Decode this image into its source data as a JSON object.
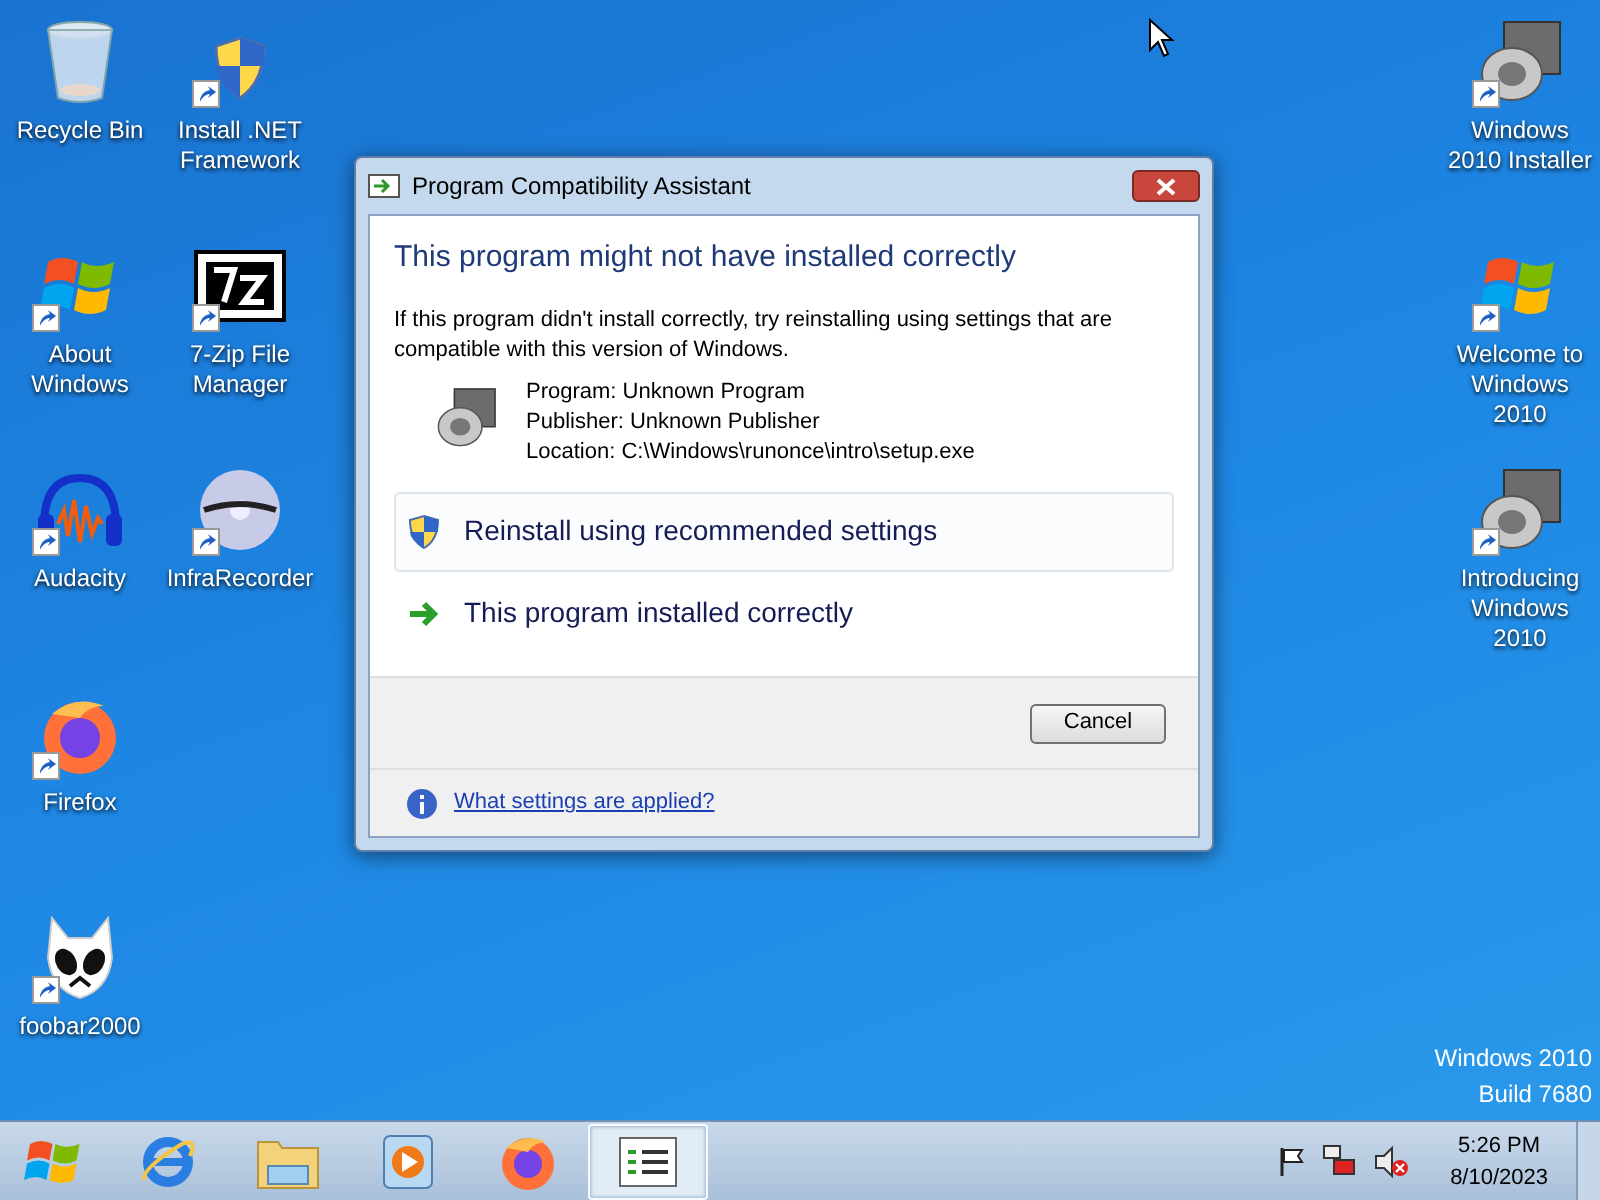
{
  "desktop": {
    "columns": [
      {
        "icons": [
          {
            "label": "Recycle Bin",
            "kind": "bin",
            "shortcut": false
          },
          {
            "label": "About Windows",
            "kind": "winlogo",
            "shortcut": true
          },
          {
            "label": "Audacity",
            "kind": "headphones",
            "shortcut": true
          },
          {
            "label": "Firefox",
            "kind": "firefox",
            "shortcut": true
          },
          {
            "label": "foobar2000",
            "kind": "foobar",
            "shortcut": true
          }
        ]
      },
      {
        "icons": [
          {
            "label": "Install .NET Framework",
            "kind": "shield",
            "shortcut": true
          },
          {
            "label": "7-Zip File Manager",
            "kind": "zip",
            "shortcut": true
          },
          {
            "label": "InfraRecorder",
            "kind": "disc",
            "shortcut": true
          }
        ]
      }
    ],
    "right_column": {
      "icons": [
        {
          "label": "Windows 2010 Installer",
          "kind": "speaker",
          "shortcut": true
        },
        {
          "label": "Welcome to Windows 2010",
          "kind": "winlogo",
          "shortcut": true
        },
        {
          "label": "Introducing Windows 2010",
          "kind": "speaker",
          "shortcut": true
        }
      ]
    },
    "version": [
      "Windows 2010",
      "Build 7680"
    ]
  },
  "dialog": {
    "title": "Program Compatibility Assistant",
    "heading": "This program might not have installed correctly",
    "message": "If this program didn't install correctly, try reinstalling using settings that are compatible with this version of Windows.",
    "details": [
      "Program: Unknown Program",
      "Publisher: Unknown Publisher",
      "Location: C:\\Windows\\runonce\\intro\\setup.exe"
    ],
    "options": [
      {
        "label": "Reinstall using recommended settings",
        "kind": "shield",
        "selected": true
      },
      {
        "label": "This program installed correctly",
        "kind": "arrow",
        "selected": false
      }
    ],
    "cancel": "Cancel",
    "link": "What settings are applied?"
  },
  "taskbar": {
    "items": [
      {
        "kind": "start",
        "selected": false
      },
      {
        "kind": "ie",
        "selected": false
      },
      {
        "kind": "explorer",
        "selected": false
      },
      {
        "kind": "media",
        "selected": false
      },
      {
        "kind": "firefox",
        "selected": false
      },
      {
        "kind": "pca",
        "selected": true
      }
    ],
    "tray": {
      "time": "5:26 PM",
      "date": "8/10/2023"
    }
  }
}
